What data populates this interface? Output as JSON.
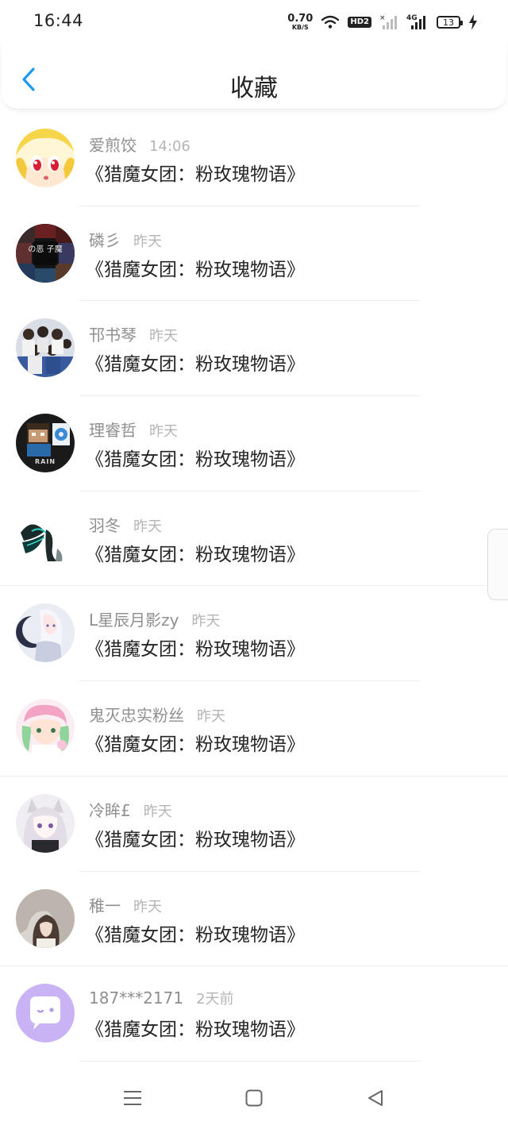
{
  "status_bar": {
    "time": "16:44",
    "net_speed_value": "0.70",
    "net_speed_unit": "KB/S",
    "hd_label": "HD2",
    "network_label": "4G",
    "battery_level": "13"
  },
  "header": {
    "title": "收藏",
    "back_icon": "chevron-left-icon",
    "accent_color": "#1d9bf0"
  },
  "favorites": [
    {
      "name": "爱煎饺",
      "time": "14:06",
      "title": "《猎魔女团：粉玫瑰物语》",
      "avatar": "anime-girl-yellow-hair"
    },
    {
      "name": "磷彡",
      "time": "昨天",
      "title": "《猎魔女团：粉玫瑰物语》",
      "avatar": "collage-dark",
      "avatar_text": "の恶 子魔"
    },
    {
      "name": "邗书琴",
      "time": "昨天",
      "title": "《猎魔女团：粉玫瑰物语》",
      "avatar": "group-photo"
    },
    {
      "name": "理睿哲",
      "time": "昨天",
      "title": "《猎魔女团：粉玫瑰物语》",
      "avatar": "minecraft-character",
      "avatar_text": "RAIN"
    },
    {
      "name": "羽冬",
      "time": "昨天",
      "title": "《猎魔女团：粉玫瑰物语》",
      "avatar": "dark-wings"
    },
    {
      "name": "L星辰月影zy",
      "time": "昨天",
      "title": "《猎魔女团：粉玫瑰物语》",
      "avatar": "white-hair-moon"
    },
    {
      "name": "鬼灭忠实粉丝",
      "time": "昨天",
      "title": "《猎魔女团：粉玫瑰物语》",
      "avatar": "pink-hair-chibi"
    },
    {
      "name": "冷眸£",
      "time": "昨天",
      "title": "《猎魔女团：粉玫瑰物语》",
      "avatar": "silver-hair-girl"
    },
    {
      "name": "稚一",
      "time": "昨天",
      "title": "《猎魔女团：粉玫瑰物语》",
      "avatar": "blurred-girl"
    },
    {
      "name": "187***2171",
      "time": "2天前",
      "title": "《猎魔女团：粉玫瑰物语》",
      "avatar": "default-chat-bubble",
      "avatar_color": "#c9b3f5"
    }
  ],
  "nav_bar": {
    "menu_icon": "menu-icon",
    "home_icon": "home-square-icon",
    "back_icon": "back-triangle-icon"
  }
}
